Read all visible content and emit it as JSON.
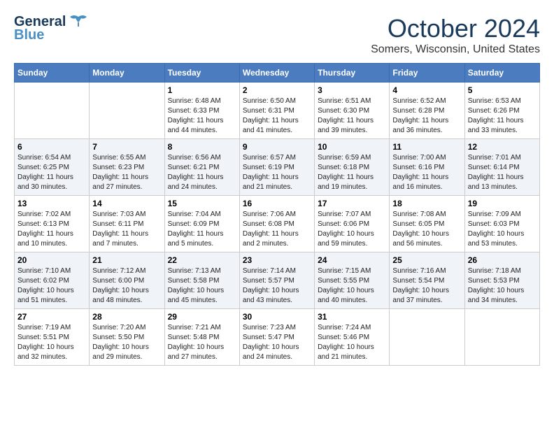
{
  "header": {
    "logo_general": "General",
    "logo_blue": "Blue",
    "month_title": "October 2024",
    "location": "Somers, Wisconsin, United States"
  },
  "days_of_week": [
    "Sunday",
    "Monday",
    "Tuesday",
    "Wednesday",
    "Thursday",
    "Friday",
    "Saturday"
  ],
  "weeks": [
    [
      {
        "day": null
      },
      {
        "day": null
      },
      {
        "day": 1,
        "sunrise": "6:48 AM",
        "sunset": "6:33 PM",
        "daylight": "11 hours and 44 minutes."
      },
      {
        "day": 2,
        "sunrise": "6:50 AM",
        "sunset": "6:31 PM",
        "daylight": "11 hours and 41 minutes."
      },
      {
        "day": 3,
        "sunrise": "6:51 AM",
        "sunset": "6:30 PM",
        "daylight": "11 hours and 39 minutes."
      },
      {
        "day": 4,
        "sunrise": "6:52 AM",
        "sunset": "6:28 PM",
        "daylight": "11 hours and 36 minutes."
      },
      {
        "day": 5,
        "sunrise": "6:53 AM",
        "sunset": "6:26 PM",
        "daylight": "11 hours and 33 minutes."
      }
    ],
    [
      {
        "day": 6,
        "sunrise": "6:54 AM",
        "sunset": "6:25 PM",
        "daylight": "11 hours and 30 minutes."
      },
      {
        "day": 7,
        "sunrise": "6:55 AM",
        "sunset": "6:23 PM",
        "daylight": "11 hours and 27 minutes."
      },
      {
        "day": 8,
        "sunrise": "6:56 AM",
        "sunset": "6:21 PM",
        "daylight": "11 hours and 24 minutes."
      },
      {
        "day": 9,
        "sunrise": "6:57 AM",
        "sunset": "6:19 PM",
        "daylight": "11 hours and 21 minutes."
      },
      {
        "day": 10,
        "sunrise": "6:59 AM",
        "sunset": "6:18 PM",
        "daylight": "11 hours and 19 minutes."
      },
      {
        "day": 11,
        "sunrise": "7:00 AM",
        "sunset": "6:16 PM",
        "daylight": "11 hours and 16 minutes."
      },
      {
        "day": 12,
        "sunrise": "7:01 AM",
        "sunset": "6:14 PM",
        "daylight": "11 hours and 13 minutes."
      }
    ],
    [
      {
        "day": 13,
        "sunrise": "7:02 AM",
        "sunset": "6:13 PM",
        "daylight": "11 hours and 10 minutes."
      },
      {
        "day": 14,
        "sunrise": "7:03 AM",
        "sunset": "6:11 PM",
        "daylight": "11 hours and 7 minutes."
      },
      {
        "day": 15,
        "sunrise": "7:04 AM",
        "sunset": "6:09 PM",
        "daylight": "11 hours and 5 minutes."
      },
      {
        "day": 16,
        "sunrise": "7:06 AM",
        "sunset": "6:08 PM",
        "daylight": "11 hours and 2 minutes."
      },
      {
        "day": 17,
        "sunrise": "7:07 AM",
        "sunset": "6:06 PM",
        "daylight": "10 hours and 59 minutes."
      },
      {
        "day": 18,
        "sunrise": "7:08 AM",
        "sunset": "6:05 PM",
        "daylight": "10 hours and 56 minutes."
      },
      {
        "day": 19,
        "sunrise": "7:09 AM",
        "sunset": "6:03 PM",
        "daylight": "10 hours and 53 minutes."
      }
    ],
    [
      {
        "day": 20,
        "sunrise": "7:10 AM",
        "sunset": "6:02 PM",
        "daylight": "10 hours and 51 minutes."
      },
      {
        "day": 21,
        "sunrise": "7:12 AM",
        "sunset": "6:00 PM",
        "daylight": "10 hours and 48 minutes."
      },
      {
        "day": 22,
        "sunrise": "7:13 AM",
        "sunset": "5:58 PM",
        "daylight": "10 hours and 45 minutes."
      },
      {
        "day": 23,
        "sunrise": "7:14 AM",
        "sunset": "5:57 PM",
        "daylight": "10 hours and 43 minutes."
      },
      {
        "day": 24,
        "sunrise": "7:15 AM",
        "sunset": "5:55 PM",
        "daylight": "10 hours and 40 minutes."
      },
      {
        "day": 25,
        "sunrise": "7:16 AM",
        "sunset": "5:54 PM",
        "daylight": "10 hours and 37 minutes."
      },
      {
        "day": 26,
        "sunrise": "7:18 AM",
        "sunset": "5:53 PM",
        "daylight": "10 hours and 34 minutes."
      }
    ],
    [
      {
        "day": 27,
        "sunrise": "7:19 AM",
        "sunset": "5:51 PM",
        "daylight": "10 hours and 32 minutes."
      },
      {
        "day": 28,
        "sunrise": "7:20 AM",
        "sunset": "5:50 PM",
        "daylight": "10 hours and 29 minutes."
      },
      {
        "day": 29,
        "sunrise": "7:21 AM",
        "sunset": "5:48 PM",
        "daylight": "10 hours and 27 minutes."
      },
      {
        "day": 30,
        "sunrise": "7:23 AM",
        "sunset": "5:47 PM",
        "daylight": "10 hours and 24 minutes."
      },
      {
        "day": 31,
        "sunrise": "7:24 AM",
        "sunset": "5:46 PM",
        "daylight": "10 hours and 21 minutes."
      },
      {
        "day": null
      },
      {
        "day": null
      }
    ]
  ]
}
